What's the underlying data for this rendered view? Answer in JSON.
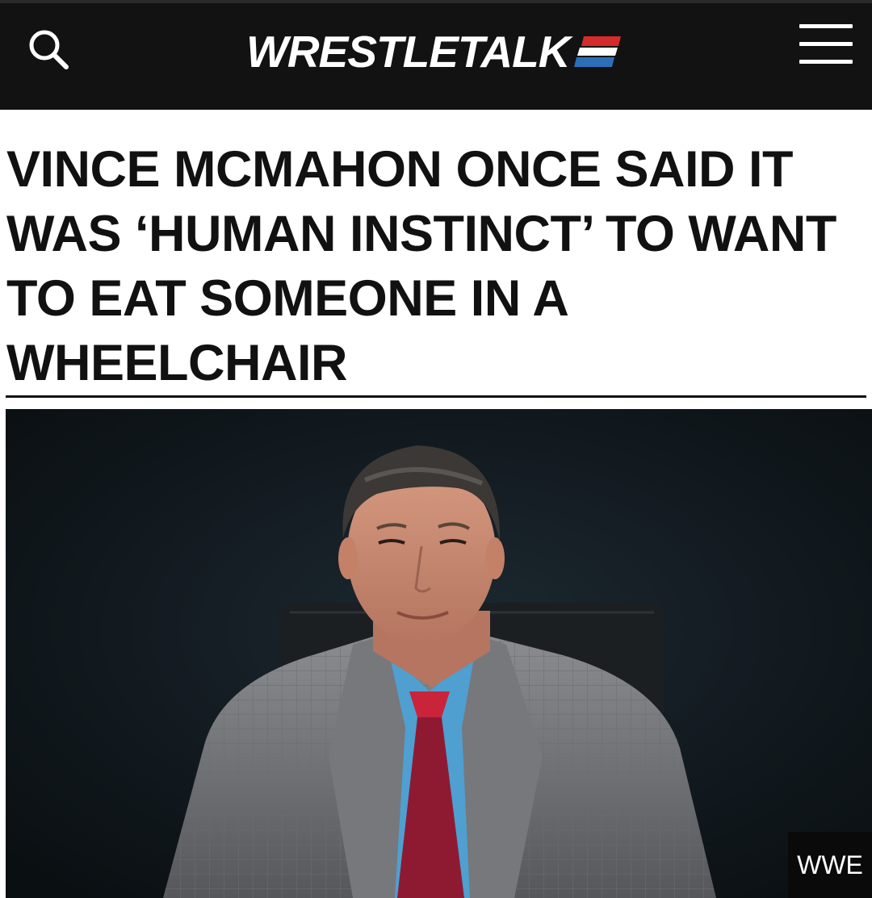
{
  "header": {
    "logo_text": "WRESTLETALK",
    "search_icon": "search-icon",
    "menu_icon": "hamburger-menu-icon",
    "background_color": "#121212",
    "flag_colors": [
      "#d62b2b",
      "#ffffff",
      "#2b6fb8"
    ]
  },
  "article": {
    "headline": "VINCE MCMAHON ONCE SAID IT WAS ‘HUMAN INSTINCT’ TO WANT TO EAT SOMEONE IN A WHEELCHAIR",
    "image_credit": "WWE"
  }
}
